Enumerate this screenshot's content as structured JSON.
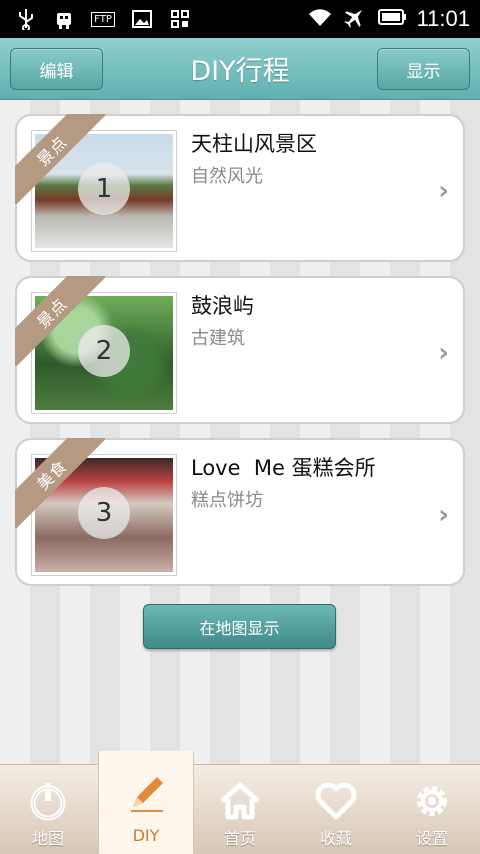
{
  "statusbar": {
    "time": "11:01",
    "icons": [
      "usb-icon",
      "android-debug-icon",
      "ftp-icon",
      "image-icon",
      "grid-icon",
      "wifi-icon",
      "airplane-icon",
      "battery-icon"
    ],
    "ftp_label": "FTP"
  },
  "header": {
    "title": "DIY行程",
    "left_button": "编辑",
    "right_button": "显示",
    "accent": "#6fbfbe"
  },
  "itinerary": [
    {
      "index": "1",
      "tag": "景点",
      "title": "天柱山风景区",
      "subtitle": "自然风光"
    },
    {
      "index": "2",
      "tag": "景点",
      "title": "鼓浪屿",
      "subtitle": "古建筑"
    },
    {
      "index": "3",
      "tag": "美食",
      "title": "Love  Me 蛋糕会所",
      "subtitle": "糕点饼坊"
    }
  ],
  "map_button": "在地图显示",
  "tabs": [
    {
      "label": "地图",
      "icon": "map-power-icon"
    },
    {
      "label": "DIY",
      "icon": "pencil-icon",
      "active": true
    },
    {
      "label": "首页",
      "icon": "home-icon"
    },
    {
      "label": "收藏",
      "icon": "heart-icon"
    },
    {
      "label": "设置",
      "icon": "gear-icon"
    }
  ]
}
